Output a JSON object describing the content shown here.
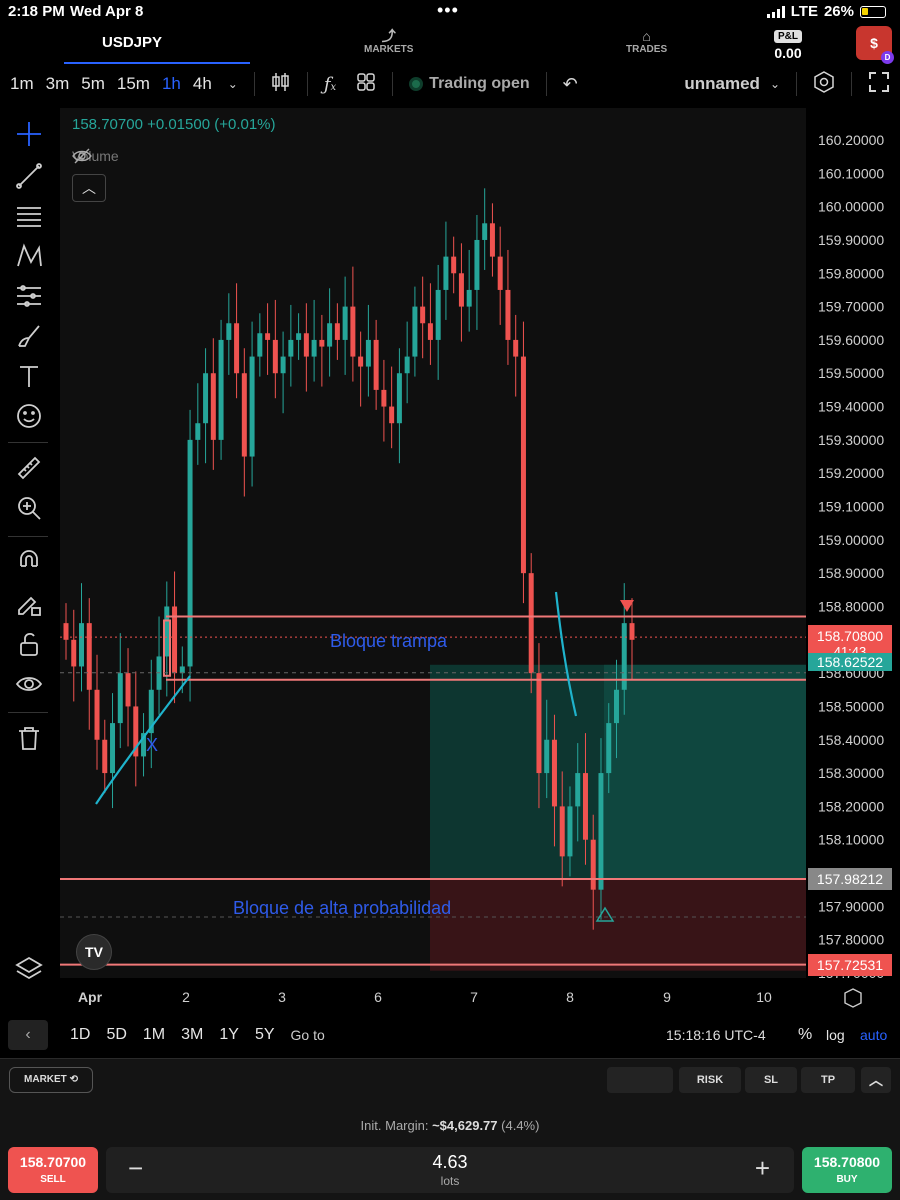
{
  "status_bar": {
    "time": "2:18 PM",
    "date": "Wed Apr 8",
    "dots": "•••",
    "carrier": "LTE",
    "battery": "26%"
  },
  "header": {
    "symbol": "USDJPY",
    "markets_label": "MARKETS",
    "trades_label": "TRADES",
    "pnl_badge": "P&L",
    "pnl_value": "0.00",
    "account_icon": "$",
    "account_badge": "D"
  },
  "toolbar": {
    "timeframes": [
      "1m",
      "3m",
      "5m",
      "15m",
      "1h",
      "4h"
    ],
    "active_timeframe": "1h",
    "trading_status": "Trading open",
    "layout_name": "unnamed",
    "icons": [
      "candles-icon",
      "indicators-icon",
      "layouts-icon",
      "undo-icon",
      "settings-hex-icon",
      "fullscreen-icon"
    ]
  },
  "sidebar": {
    "tools": [
      "crosshair-icon",
      "trendline-icon",
      "fib-lines-icon",
      "pattern-icon",
      "prediction-icon",
      "brush-icon",
      "text-icon",
      "emoji-icon",
      "ruler-icon",
      "zoom-icon",
      "magnet-icon",
      "lock-drawing-icon",
      "unlock-icon",
      "eye-icon",
      "trash-icon",
      "layers-icon"
    ]
  },
  "chart": {
    "legend": "158.70700 +0.01500 (+0.01%)",
    "volume_label": "Volume",
    "annotation_trap": "Bloque trampa",
    "annotation_high_prob": "Bloque de alta probabilidad",
    "annotation_x": "X",
    "logo": "TV",
    "price_current": "158.70800",
    "countdown": "41:43",
    "price_green": "158.62522",
    "price_gray": "157.98212",
    "price_red": "157.72531",
    "colors": {
      "up": "#26a69a",
      "down": "#ef5350",
      "zone_line": "#f07878",
      "tp_zone": "#0d3b34",
      "sl_zone": "#3b1518",
      "trend_line": "#1fb3cc"
    }
  },
  "chart_data": {
    "type": "candlestick",
    "y_ticks": [
      "160.20000",
      "160.10000",
      "160.00000",
      "159.90000",
      "159.80000",
      "159.70000",
      "159.60000",
      "159.50000",
      "159.40000",
      "159.30000",
      "159.20000",
      "159.10000",
      "159.00000",
      "158.90000",
      "158.80000",
      "158.70000",
      "158.60000",
      "158.50000",
      "158.40000",
      "158.30000",
      "158.20000",
      "158.10000",
      "158.00000",
      "157.90000",
      "157.80000",
      "157.70000"
    ],
    "ylim": [
      157.62,
      160.26
    ],
    "x_ticks": [
      "Apr",
      "2",
      "3",
      "6",
      "7",
      "8",
      "9",
      "10"
    ],
    "levels": {
      "trap_top": 158.77,
      "trap_bottom": 158.58,
      "current": 158.708,
      "tp_top": 158.625,
      "entry": 157.982,
      "stop": 157.725
    },
    "closes": [
      158.7,
      158.62,
      158.75,
      158.55,
      158.4,
      158.3,
      158.45,
      158.6,
      158.5,
      158.35,
      158.42,
      158.55,
      158.65,
      158.8,
      158.6,
      158.62,
      159.3,
      159.35,
      159.5,
      159.3,
      159.6,
      159.65,
      159.5,
      159.25,
      159.55,
      159.62,
      159.6,
      159.5,
      159.55,
      159.6,
      159.62,
      159.55,
      159.6,
      159.58,
      159.65,
      159.6,
      159.7,
      159.55,
      159.52,
      159.6,
      159.45,
      159.4,
      159.35,
      159.5,
      159.55,
      159.7,
      159.65,
      159.6,
      159.75,
      159.85,
      159.8,
      159.7,
      159.75,
      159.9,
      159.95,
      159.85,
      159.75,
      159.6,
      159.55,
      158.9,
      158.6,
      158.3,
      158.4,
      158.2,
      158.05,
      158.2,
      158.3,
      158.1,
      157.95,
      158.3,
      158.45,
      158.55,
      158.75,
      158.7
    ]
  },
  "range_bar": {
    "ranges": [
      "1D",
      "5D",
      "1M",
      "3M",
      "1Y",
      "5Y"
    ],
    "goto": "Go to",
    "clock": "15:18:16 UTC-4",
    "percent": "%",
    "log": "log",
    "auto": "auto"
  },
  "order_panel": {
    "market": "MARKET",
    "risk": "RISK",
    "sl": "SL",
    "tp": "TP",
    "margin_label": "Init. Margin:",
    "margin_value": "~$4,629.77",
    "margin_pct": "(4.4%)",
    "sell_price": "158.70700",
    "sell_label": "SELL",
    "buy_price": "158.70800",
    "buy_label": "BUY",
    "lots_value": "4.63",
    "lots_unit": "lots",
    "minus": "−",
    "plus": "+"
  }
}
